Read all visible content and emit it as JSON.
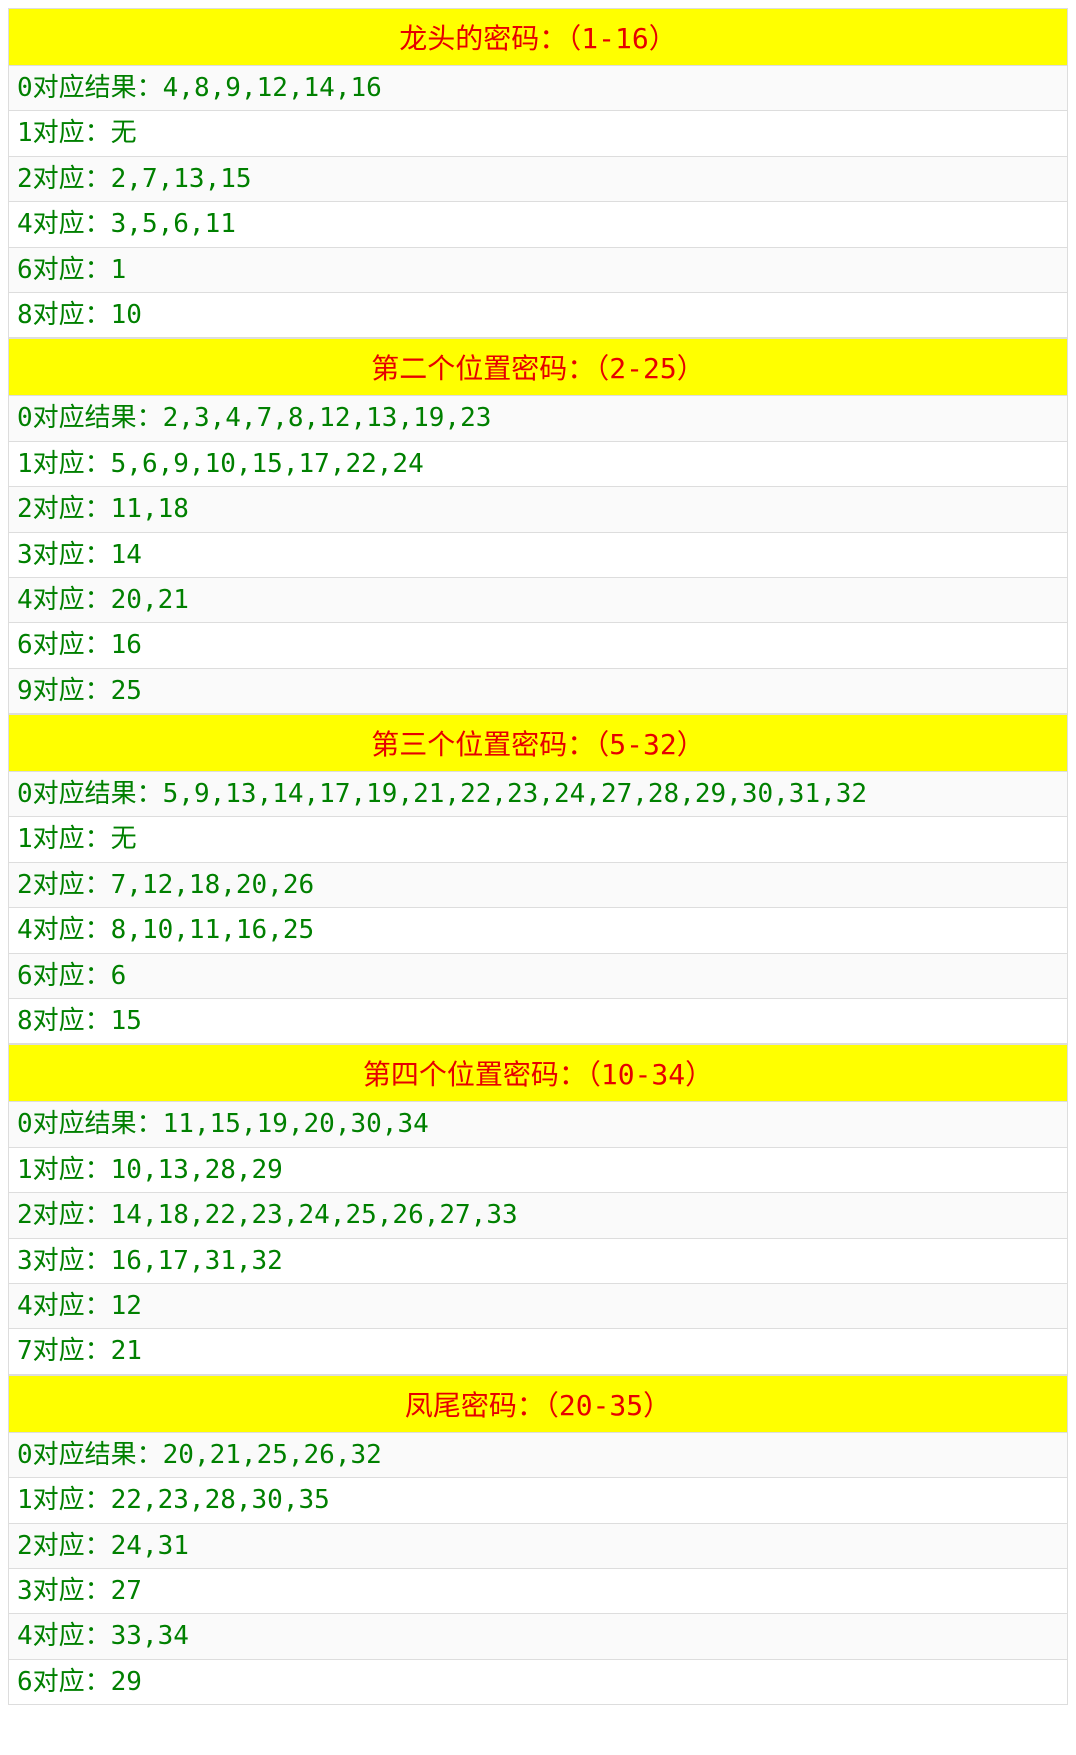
{
  "sections": [
    {
      "title": "龙头的密码：（1-16）",
      "rows": [
        "0对应结果：4,8,9,12,14,16",
        "1对应：无",
        "2对应：2,7,13,15",
        "4对应：3,5,6,11",
        "6对应：1",
        "8对应：10"
      ]
    },
    {
      "title": "第二个位置密码：（2-25）",
      "rows": [
        "0对应结果：2,3,4,7,8,12,13,19,23",
        "1对应：5,6,9,10,15,17,22,24",
        "2对应：11,18",
        "3对应：14",
        "4对应：20,21",
        "6对应：16",
        "9对应：25"
      ]
    },
    {
      "title": "第三个位置密码：（5-32）",
      "rows": [
        "0对应结果：5,9,13,14,17,19,21,22,23,24,27,28,29,30,31,32",
        "1对应：无",
        "2对应：7,12,18,20,26",
        "4对应：8,10,11,16,25",
        "6对应：6",
        "8对应：15"
      ]
    },
    {
      "title": "第四个位置密码：（10-34）",
      "rows": [
        "0对应结果：11,15,19,20,30,34",
        "1对应：10,13,28,29",
        "2对应：14,18,22,23,24,25,26,27,33",
        "3对应：16,17,31,32",
        "4对应：12",
        "7对应：21"
      ]
    },
    {
      "title": "凤尾密码：（20-35）",
      "rows": [
        "0对应结果：20,21,25,26,32",
        "1对应：22,23,28,30,35",
        "2对应：24,31",
        "3对应：27",
        "4对应：33,34",
        "6对应：29"
      ]
    }
  ]
}
